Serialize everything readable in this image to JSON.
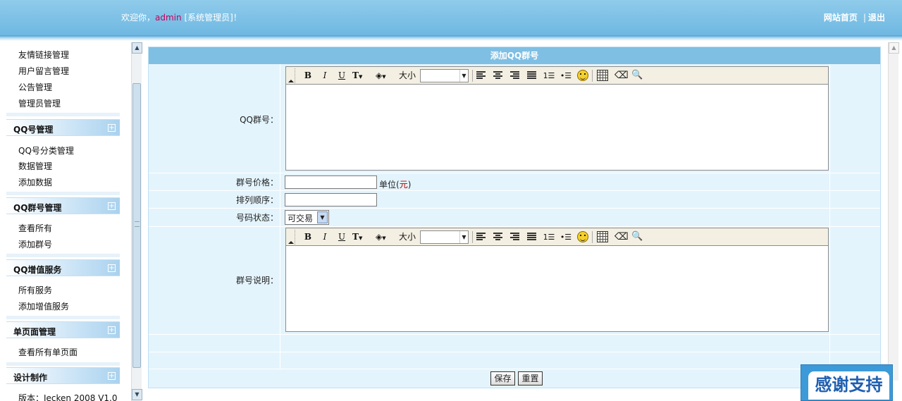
{
  "header": {
    "welcome_prefix": "欢迎你，",
    "username": "admin",
    "role": " [系统管理员]！",
    "links": [
      "网站首页",
      "退出"
    ],
    "link_separator": "|"
  },
  "sidebar": {
    "top_items": [
      "友情链接管理",
      "用户留言管理",
      "公告管理",
      "管理员管理"
    ],
    "groups": [
      {
        "title": "QQ号管理",
        "items": [
          "QQ号分类管理",
          "数据管理",
          "添加数据"
        ]
      },
      {
        "title": "QQ群号管理",
        "items": [
          "查看所有",
          "添加群号"
        ]
      },
      {
        "title": "QQ增值服务",
        "items": [
          "所有服务",
          "添加增值服务"
        ]
      },
      {
        "title": "单页面管理",
        "items": [
          "查看所有单页面"
        ]
      },
      {
        "title": "设计制作",
        "items": [
          "版本：Jecken 2008 V1.0"
        ]
      }
    ],
    "expand_symbol": "+"
  },
  "form": {
    "title": "添加QQ群号",
    "fields": {
      "group_number": {
        "label": "QQ群号："
      },
      "price": {
        "label": "群号价格：",
        "value": "",
        "unit_prefix": "单位(",
        "unit_currency": "元",
        "unit_suffix": ")"
      },
      "order": {
        "label": "排列顺序：",
        "value": ""
      },
      "status": {
        "label": "号码状态：",
        "selected": "可交易"
      },
      "description": {
        "label": "群号说明："
      }
    },
    "editor_toolbar": {
      "bold": "B",
      "italic": "I",
      "underline": "U",
      "font_color": "T",
      "bg_color": "◈",
      "size_label": "大小",
      "size_value": ""
    },
    "buttons": {
      "save": "保存",
      "reset": "重置"
    }
  },
  "badge": {
    "text": "感谢支持"
  },
  "colors": {
    "header": "#7fc1e8",
    "title_bar": "#7fbfe3",
    "form_bg": "#e4f4fd",
    "username": "#c4005a",
    "currency": "#b30000"
  }
}
